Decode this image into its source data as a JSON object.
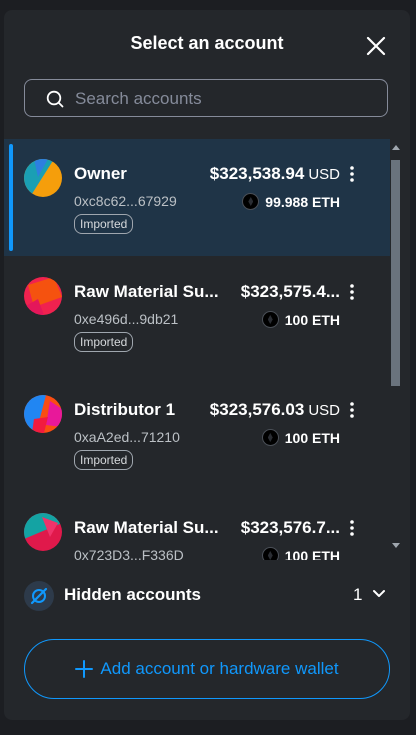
{
  "header": {
    "title": "Select an account"
  },
  "search": {
    "placeholder": "Search accounts"
  },
  "accounts": [
    {
      "name": "Owner",
      "balance": "$323,538.94",
      "currency": "USD",
      "address": "0xc8c62...67929",
      "eth": "99.988 ETH",
      "badge": "Imported",
      "selected": true
    },
    {
      "name": "Raw Material Su...",
      "balance": "$323,575.4...",
      "currency": "",
      "address": "0xe496d...9db21",
      "eth": "100 ETH",
      "badge": "Imported",
      "selected": false
    },
    {
      "name": "Distributor 1",
      "balance": "$323,576.03",
      "currency": "USD",
      "address": "0xaA2ed...71210",
      "eth": "100 ETH",
      "badge": "Imported",
      "selected": false
    },
    {
      "name": "Raw Material Su...",
      "balance": "$323,576.7...",
      "currency": "",
      "address": "0x723D3...F336D",
      "eth": "100 ETH",
      "badge": "",
      "selected": false
    }
  ],
  "hidden_accounts": {
    "label": "Hidden accounts",
    "count": "1"
  },
  "add_account": {
    "label": "Add account or hardware wallet"
  },
  "colors": {
    "accent": "#1098fc",
    "selected_bg": "#1f3447",
    "modal_bg": "#24272b"
  }
}
